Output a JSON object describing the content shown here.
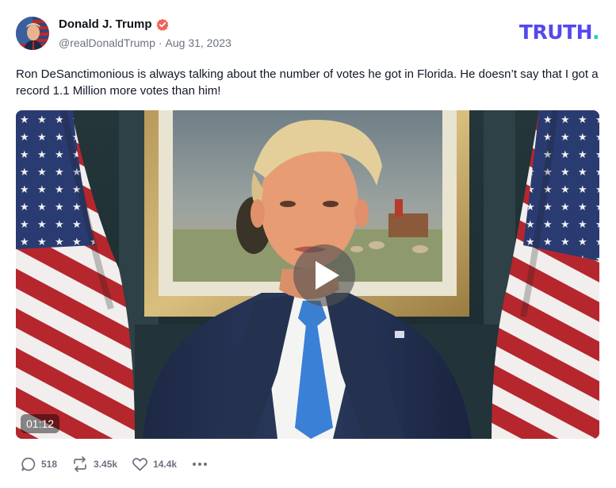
{
  "author": {
    "display_name": "Donald J. Trump",
    "handle": "@realDonaldTrump",
    "separator": "·",
    "date": "Aug 31, 2023",
    "verified": true,
    "verified_color": "#f0645a"
  },
  "brand": {
    "logo_text": "TRUTH",
    "logo_dot": ".",
    "logo_color": "#5448ee",
    "logo_dot_color": "#17d2c8"
  },
  "post": {
    "text": "Ron DeSanctimonious is always talking about the number of votes he got in Florida. He doesn’t say that I got a record 1.1 Million more votes than him!"
  },
  "video": {
    "duration": "01:12",
    "play_icon": "play-icon"
  },
  "actions": {
    "replies": "518",
    "retruths": "3.45k",
    "likes": "14.4k",
    "icon_names": [
      "reply-icon",
      "retruth-icon",
      "like-icon",
      "more-icon"
    ]
  }
}
